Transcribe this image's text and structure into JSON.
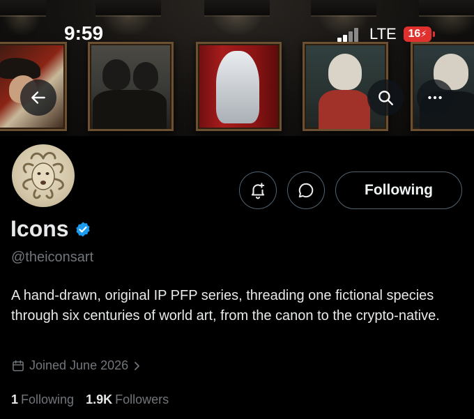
{
  "status_bar": {
    "time": "9:59",
    "network": "LTE",
    "battery": "16"
  },
  "banner": {
    "paintings": 5
  },
  "profile": {
    "display_name": "Icons",
    "verified": true,
    "handle": "@theiconsart",
    "bio": "A hand-drawn, original IP PFP series, threading one fictional species through six centuries of world art, from the canon to the crypto-native.",
    "joined": "Joined June 2026",
    "following_count": "1",
    "following_label": "Following",
    "followers_count": "1.9K",
    "followers_label": "Followers"
  },
  "actions": {
    "following_button": "Following"
  },
  "colors": {
    "background": "#000000",
    "primary_text": "#e7e9ea",
    "secondary_text": "#71767b",
    "verified_blue": "#1d9bf0",
    "battery_red": "#e0312f"
  },
  "icons": {
    "back": "arrow-left-icon",
    "search": "search-icon",
    "more": "more-horizontal-icon",
    "notify": "bell-plus-icon",
    "message": "chat-bubble-icon",
    "verified": "verified-badge-icon",
    "calendar": "calendar-icon"
  }
}
